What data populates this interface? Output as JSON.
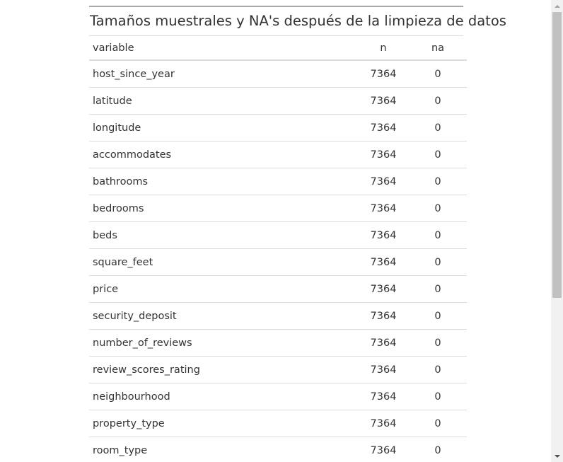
{
  "table": {
    "caption": "Tamaños muestrales y NA's después de la limpieza de datos",
    "columns": [
      "variable",
      "n",
      "na"
    ],
    "rows": [
      {
        "variable": "host_since_year",
        "n": "7364",
        "na": "0"
      },
      {
        "variable": "latitude",
        "n": "7364",
        "na": "0"
      },
      {
        "variable": "longitude",
        "n": "7364",
        "na": "0"
      },
      {
        "variable": "accommodates",
        "n": "7364",
        "na": "0"
      },
      {
        "variable": "bathrooms",
        "n": "7364",
        "na": "0"
      },
      {
        "variable": "bedrooms",
        "n": "7364",
        "na": "0"
      },
      {
        "variable": "beds",
        "n": "7364",
        "na": "0"
      },
      {
        "variable": "square_feet",
        "n": "7364",
        "na": "0"
      },
      {
        "variable": "price",
        "n": "7364",
        "na": "0"
      },
      {
        "variable": "security_deposit",
        "n": "7364",
        "na": "0"
      },
      {
        "variable": "number_of_reviews",
        "n": "7364",
        "na": "0"
      },
      {
        "variable": "review_scores_rating",
        "n": "7364",
        "na": "0"
      },
      {
        "variable": "neighbourhood",
        "n": "7364",
        "na": "0"
      },
      {
        "variable": "property_type",
        "n": "7364",
        "na": "0"
      },
      {
        "variable": "room_type",
        "n": "7364",
        "na": "0"
      }
    ]
  },
  "scrollbar": {
    "up_icon": "scroll-up-arrow-icon",
    "down_icon": "scroll-down-arrow-icon"
  }
}
